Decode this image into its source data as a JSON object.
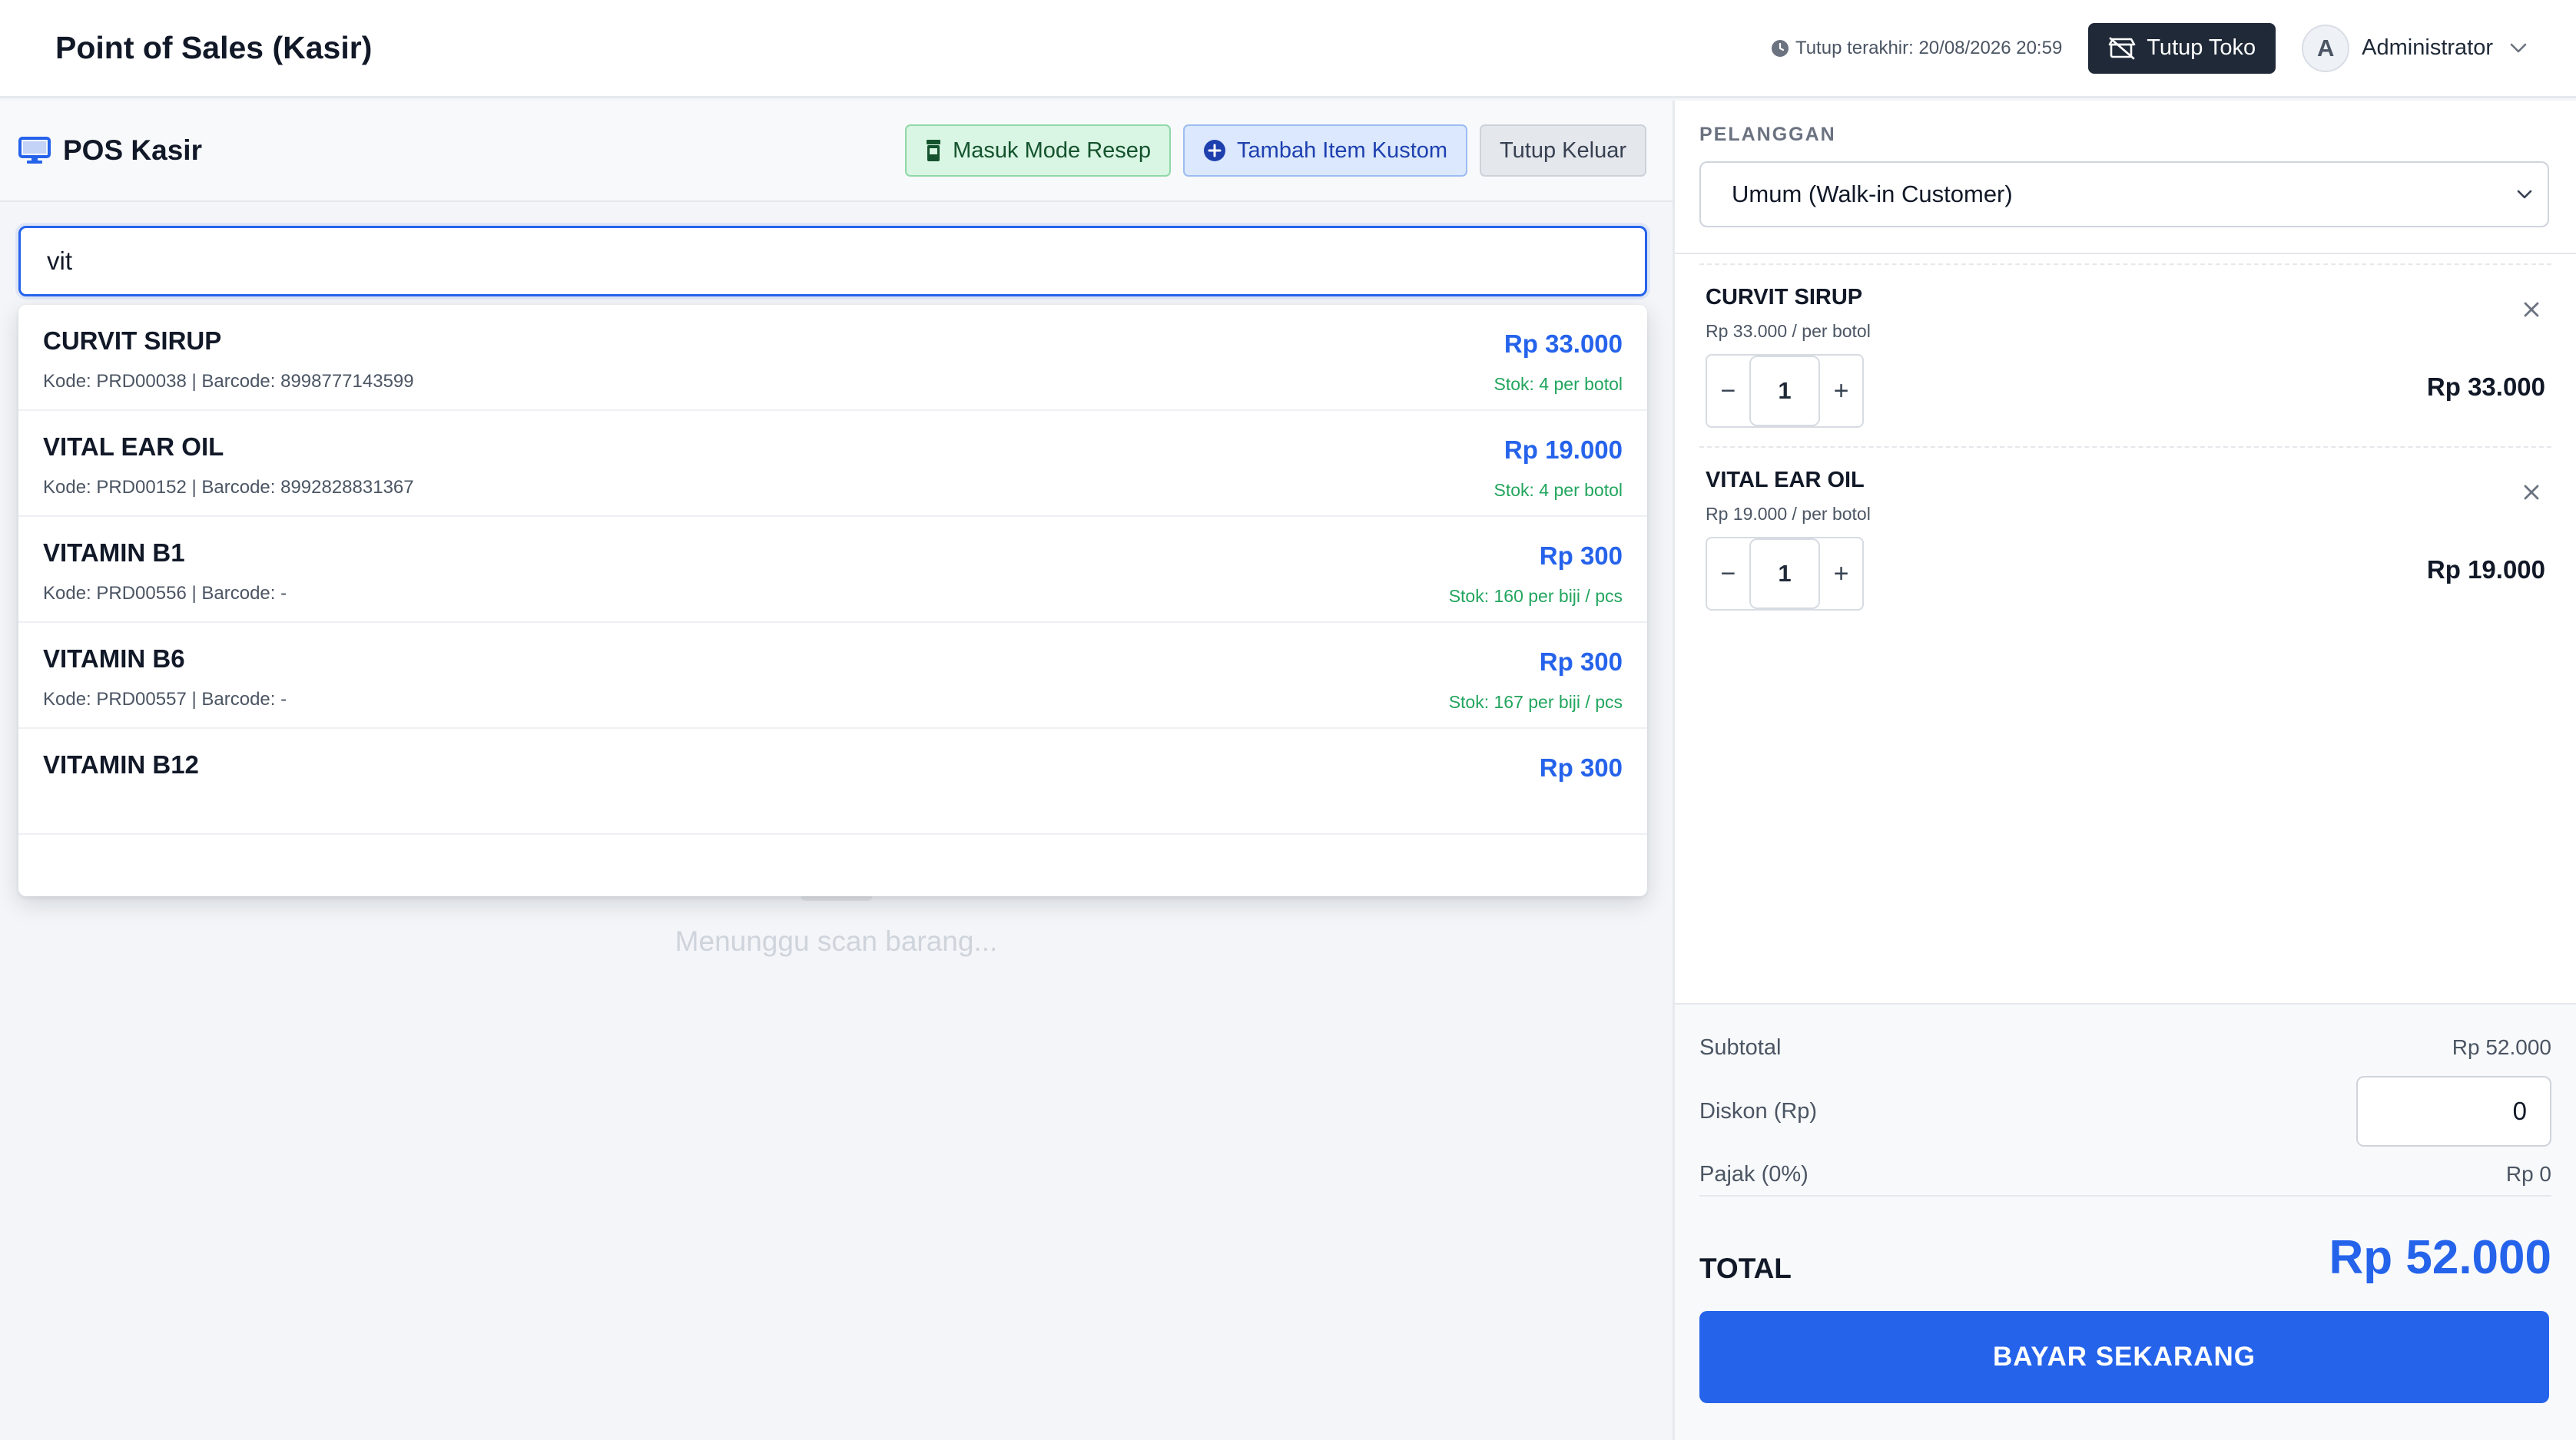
{
  "header": {
    "title": "Point of Sales (Kasir)",
    "last_close": "Tutup terakhir: 20/08/2026 20:59",
    "close_store_label": "Tutup Toko",
    "user_initial": "A",
    "user_name": "Administrator"
  },
  "pos": {
    "title": "POS Kasir",
    "actions": {
      "resep_label": "Masuk Mode Resep",
      "custom_label": "Tambah Item Kustom",
      "exit_label": "Tutup Keluar"
    },
    "search": {
      "value": "vit"
    },
    "results": [
      {
        "name": "CURVIT SIRUP",
        "meta": "Kode: PRD00038 | Barcode: 8998777143599",
        "price": "Rp 33.000",
        "stock": "Stok: 4 per botol"
      },
      {
        "name": "VITAL EAR OIL",
        "meta": "Kode: PRD00152 | Barcode: 8992828831367",
        "price": "Rp 19.000",
        "stock": "Stok: 4 per botol"
      },
      {
        "name": "VITAMIN B1",
        "meta": "Kode: PRD00556 | Barcode: -",
        "price": "Rp 300",
        "stock": "Stok: 160 per biji / pcs"
      },
      {
        "name": "VITAMIN B6",
        "meta": "Kode: PRD00557 | Barcode: -",
        "price": "Rp 300",
        "stock": "Stok: 167 per biji / pcs"
      },
      {
        "name": "VITAMIN B12",
        "meta": "",
        "price": "Rp 300",
        "stock": ""
      }
    ],
    "empty_text": "Menunggu scan barang..."
  },
  "customer": {
    "label": "PELANGGAN",
    "selected": "Umum (Walk-in Customer)"
  },
  "cart": [
    {
      "name": "CURVIT SIRUP",
      "unit": "Rp 33.000 / per botol",
      "qty": "1",
      "total": "Rp 33.000"
    },
    {
      "name": "VITAL EAR OIL",
      "unit": "Rp 19.000 / per botol",
      "qty": "1",
      "total": "Rp 19.000"
    }
  ],
  "summary": {
    "subtotal_label": "Subtotal",
    "subtotal_value": "Rp 52.000",
    "discount_label": "Diskon (Rp)",
    "discount_value": "0",
    "tax_label": "Pajak (0%)",
    "tax_value": "Rp 0",
    "total_label": "TOTAL",
    "total_value": "Rp 52.000",
    "pay_label": "BAYAR SEKARANG"
  },
  "colors": {
    "accent": "#2563eb",
    "stock_green": "#22a55e",
    "dark_button": "#1f2937"
  },
  "icons": {
    "clock": "clock-icon",
    "store_closed": "store-closed-icon",
    "monitor": "monitor-icon",
    "prescription": "prescription-bottle-icon",
    "add_circle": "plus-circle-icon",
    "basket": "basket-icon",
    "chevron": "chevron-down-icon",
    "close": "close-icon"
  }
}
